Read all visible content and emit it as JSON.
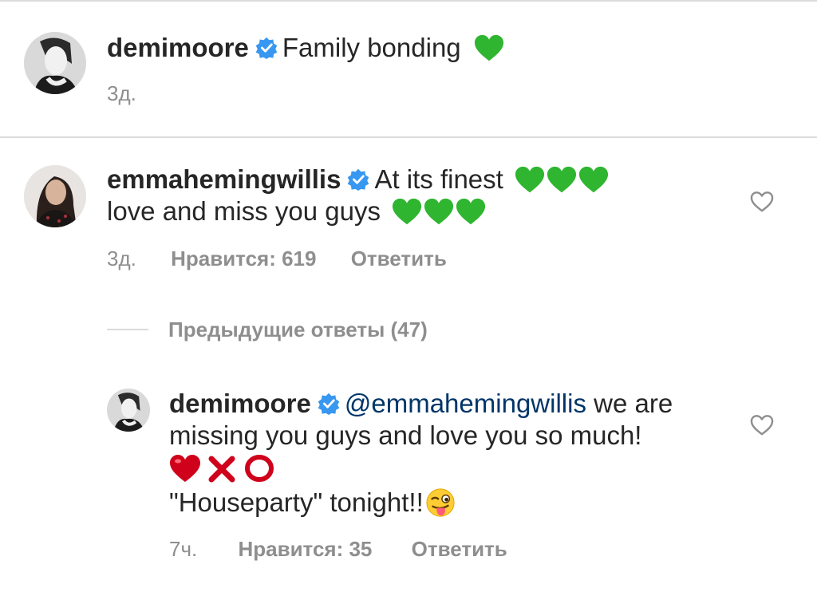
{
  "caption": {
    "username": "demimoore",
    "text": "Family bonding",
    "time": "3д."
  },
  "comment1": {
    "username": "emmahemingwillis",
    "text1": "At its finest",
    "text2": "love and miss you guys",
    "time": "3д.",
    "likes": "Нравится: 619",
    "reply": "Ответить"
  },
  "previous_replies": "Предыдущие ответы (47)",
  "reply1": {
    "username": "demimoore",
    "mention": "@emmahemingwillis",
    "text1": "we are",
    "text2": "missing you guys and love you so much!",
    "text3": "\"Houseparty\" tonight!!",
    "time": "7ч.",
    "likes": "Нравится: 35",
    "reply": "Ответить"
  },
  "colors": {
    "green_heart": "#2fb52f",
    "verified": "#3897f0",
    "mention": "#003569",
    "meta": "#8e8e8e",
    "red": "#d0021b"
  },
  "icons": [
    "verified-badge-icon",
    "green-heart-icon",
    "red-heart-icon",
    "cross-mark-icon",
    "circle-icon",
    "winking-tongue-emoji-icon",
    "heart-outline-icon"
  ]
}
